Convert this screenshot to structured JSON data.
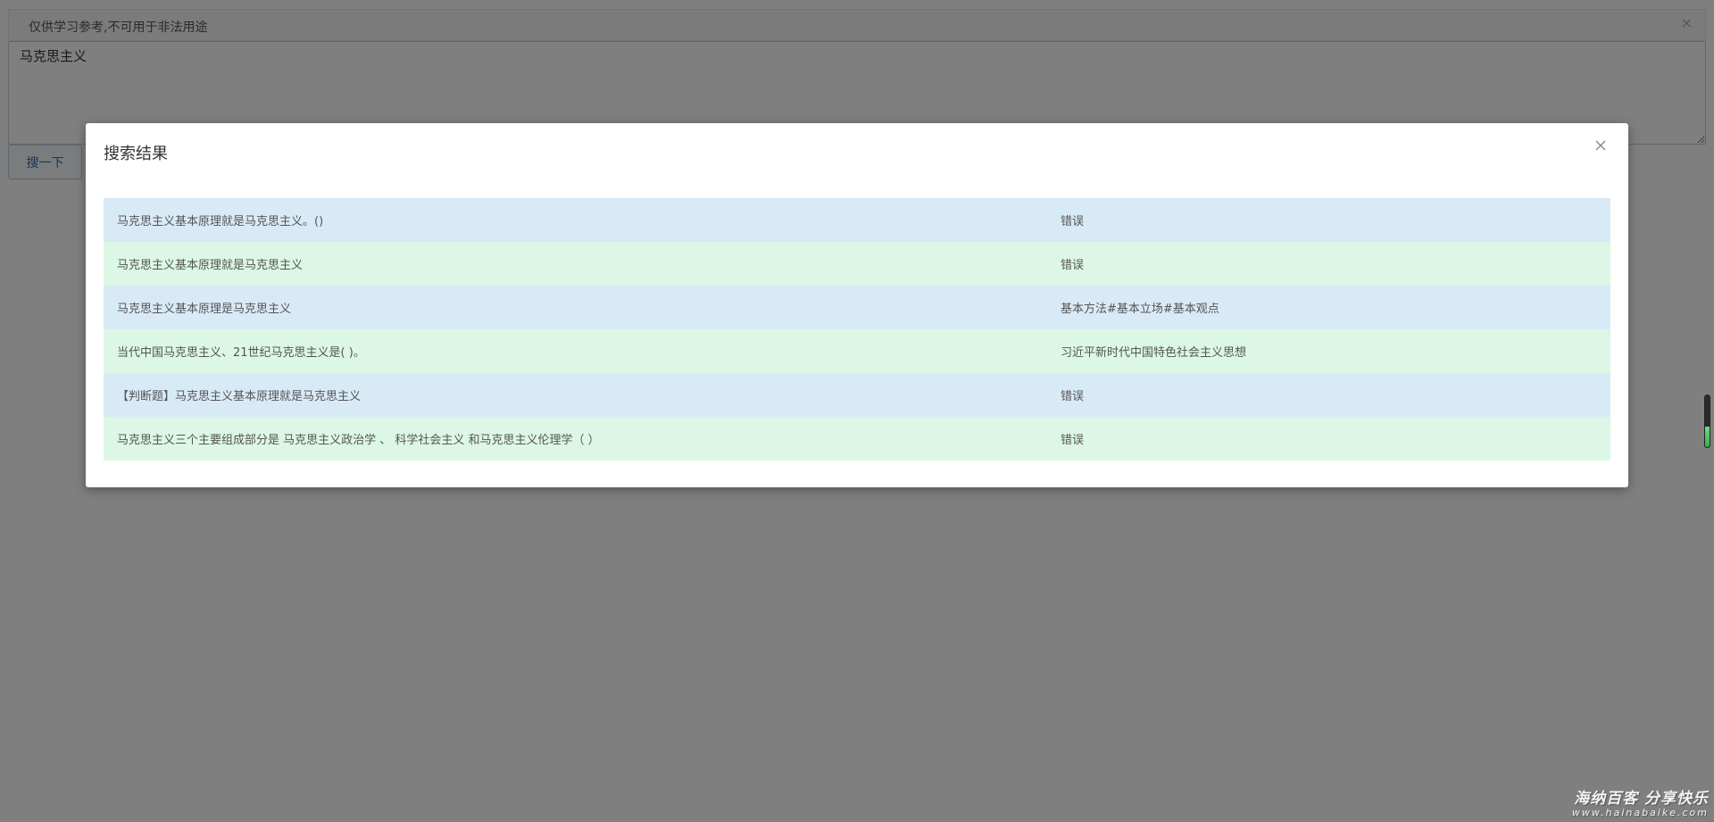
{
  "page": {
    "notice": "仅供学习参考,不可用于非法用途",
    "notice_close": "×",
    "query_value": "马克思主义",
    "search_label": "搜一下"
  },
  "modal": {
    "title": "搜索结果",
    "results": [
      {
        "question": "马克思主义基本原理就是马克思主义。()",
        "answer": "错误"
      },
      {
        "question": "马克思主义基本原理就是马克思主义",
        "answer": "错误"
      },
      {
        "question": "马克思主义基本原理是马克思主义",
        "answer": "基本方法#基本立场#基本观点"
      },
      {
        "question": "当代中国马克思主义、21世纪马克思主义是( )。",
        "answer": "习近平新时代中国特色社会主义思想"
      },
      {
        "question": "【判断题】马克思主义基本原理就是马克思主义",
        "answer": "错误"
      },
      {
        "question": "马克思主义三个主要组成部分是 马克思主义政治学 、 科学社会主义 和马克思主义伦理学（ ）",
        "answer": "错误"
      }
    ]
  },
  "scroll_indicator": {
    "level": 0.4
  },
  "watermark": {
    "main": "海纳百客 分享快乐",
    "sub": "www.hainabaike.com"
  },
  "colors": {
    "row_blue": "#d9eaf7",
    "row_green": "#dcf7e5",
    "button_text": "#2e6db4"
  }
}
